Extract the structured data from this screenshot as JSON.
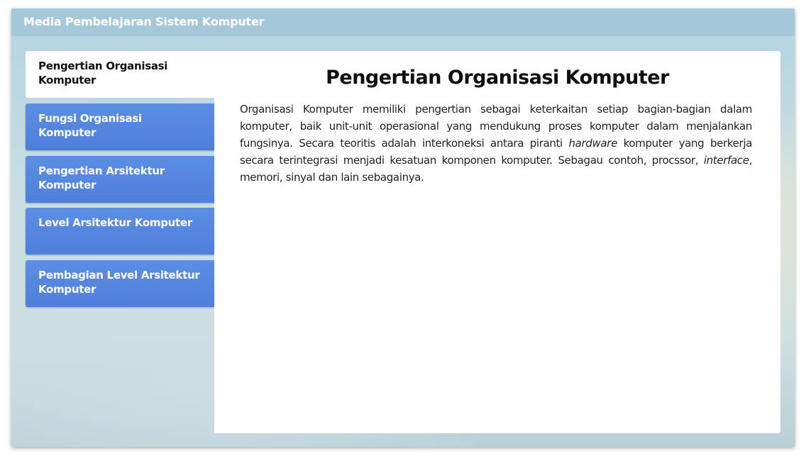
{
  "app": {
    "title": "Media Pembelajaran Sistem Komputer"
  },
  "nav": {
    "items": [
      {
        "label": "Pengertian Organisasi Komputer",
        "active": true
      },
      {
        "label": "Fungsi Organisasi Komputer",
        "active": false
      },
      {
        "label": "Pengertian Arsitektur Komputer",
        "active": false
      },
      {
        "label": "Level Arsitektur Komputer",
        "active": false
      },
      {
        "label": "Pembagian Level Arsitektur Komputer",
        "active": false
      }
    ]
  },
  "content": {
    "heading": "Pengertian Organisasi Komputer",
    "paragraph": {
      "part1": "Organisasi Komputer memiliki pengertian sebagai keterkaitan setiap bagian-bagian dalam komputer, baik unit-unit operasional yang mendukung proses komputer dalam menjalankan fungsinya. Secara teoritis adalah interkoneksi antara piranti ",
      "em1": "hardware",
      "part2": " komputer yang berkerja secara terintegrasi menjadi kesatuan komponen komputer. Sebagau contoh, procssor, ",
      "em2": "interface",
      "part3": ", memori, sinyal dan lain sebagainya."
    }
  },
  "colors": {
    "titlebar": "#a4c8da",
    "nav_button": "#5287df",
    "nav_active": "#ffffff",
    "panel": "#ffffff"
  }
}
